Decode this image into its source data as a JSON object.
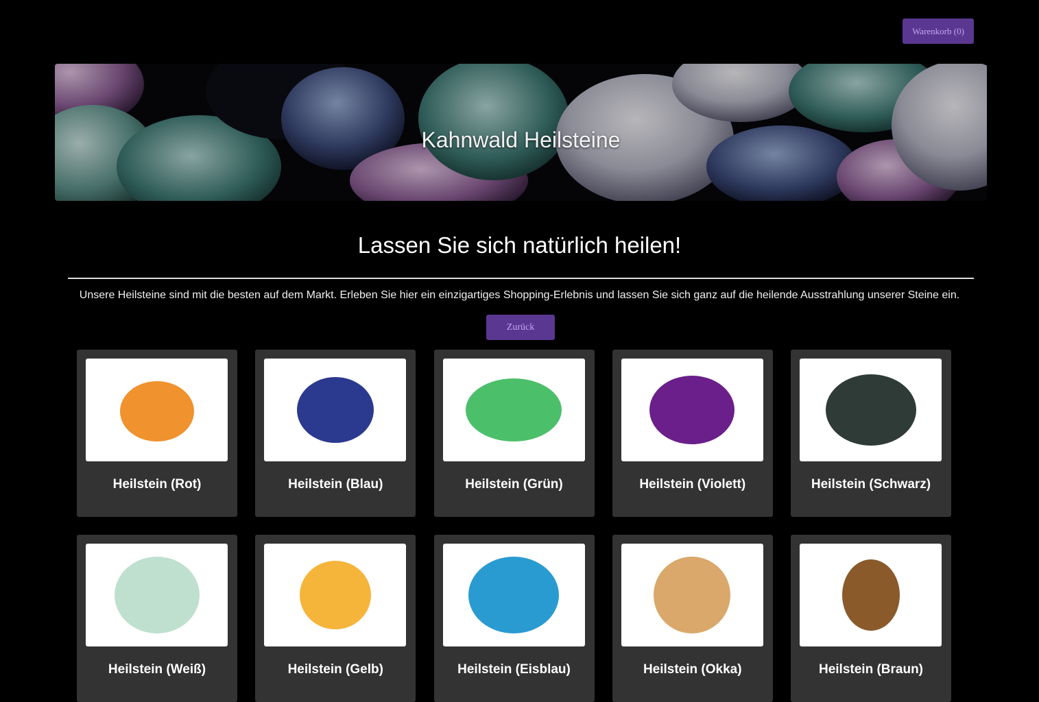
{
  "header": {
    "cart_label": "Warenkorb (0)"
  },
  "hero": {
    "title": "Kahnwald Heilsteine"
  },
  "main": {
    "headline": "Lassen Sie sich natürlich heilen!",
    "intro": "Unsere Heilsteine sind mit die besten auf dem Markt. Erleben Sie hier ein einzigartiges Shopping-Erlebnis und lassen Sie sich ganz auf die heilende Ausstrahlung unserer Steine ein.",
    "back_label": "Zurück"
  },
  "products": [
    {
      "name": "Heilstein (Rot)",
      "color": "#f0922d"
    },
    {
      "name": "Heilstein (Blau)",
      "color": "#2b3a8f"
    },
    {
      "name": "Heilstein (Grün)",
      "color": "#4cbf6a"
    },
    {
      "name": "Heilstein (Violett)",
      "color": "#6a1f8a"
    },
    {
      "name": "Heilstein (Schwarz)",
      "color": "#2f3b36"
    },
    {
      "name": "Heilstein (Weiß)",
      "color": "#bfe0cf"
    },
    {
      "name": "Heilstein (Gelb)",
      "color": "#f5b43a"
    },
    {
      "name": "Heilstein (Eisblau)",
      "color": "#2a9bd0"
    },
    {
      "name": "Heilstein (Okka)",
      "color": "#d9a86a"
    },
    {
      "name": "Heilstein (Braun)",
      "color": "#8a5a2b"
    }
  ],
  "colors": {
    "accent": "#5a3791",
    "card_bg": "#333333",
    "page_bg": "#000000"
  }
}
